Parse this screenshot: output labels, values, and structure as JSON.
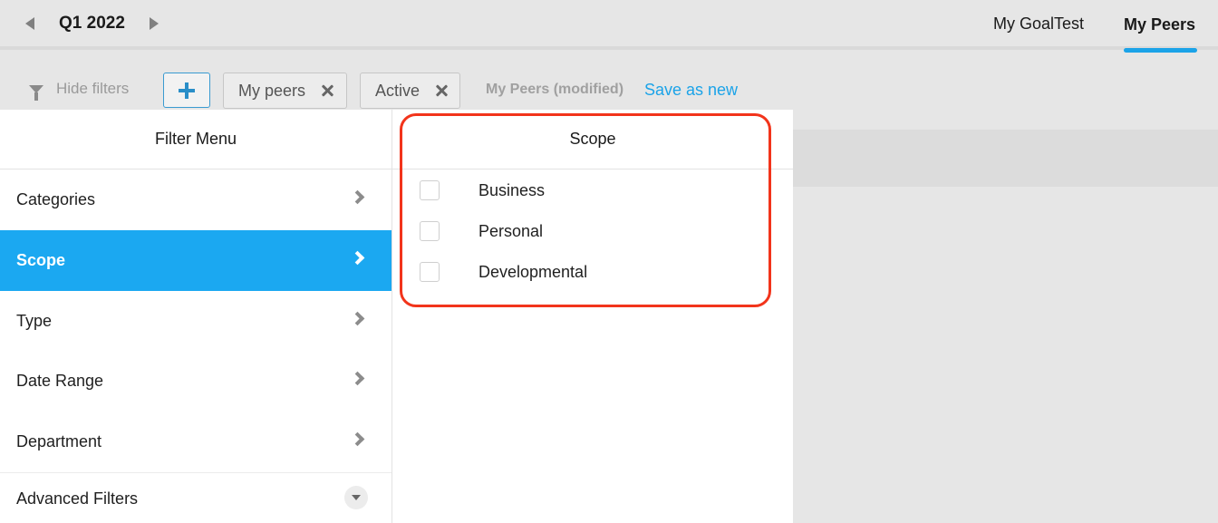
{
  "header": {
    "period": "Q1 2022",
    "tabs": [
      {
        "label": "My GoalTest",
        "active": false
      },
      {
        "label": "My Peers",
        "active": true
      }
    ]
  },
  "filter_bar": {
    "hide_filters_label": "Hide filters",
    "chips": [
      {
        "label": "My peers"
      },
      {
        "label": "Active"
      }
    ],
    "modified_label": "My Peers (modified)",
    "save_as_new_label": "Save as new"
  },
  "filter_menu": {
    "title": "Filter Menu",
    "items": [
      {
        "label": "Categories",
        "active": false
      },
      {
        "label": "Scope",
        "active": true
      },
      {
        "label": "Type",
        "active": false
      },
      {
        "label": "Date Range",
        "active": false
      },
      {
        "label": "Department",
        "active": false
      }
    ],
    "advanced_label": "Advanced Filters"
  },
  "scope_panel": {
    "title": "Scope",
    "options": [
      {
        "label": "Business",
        "checked": false
      },
      {
        "label": "Personal",
        "checked": false
      },
      {
        "label": "Developmental",
        "checked": false
      }
    ]
  },
  "colors": {
    "accent": "#1ba3e8",
    "active_menu_bg": "#1ba8f1",
    "highlight": "#f2341b"
  }
}
